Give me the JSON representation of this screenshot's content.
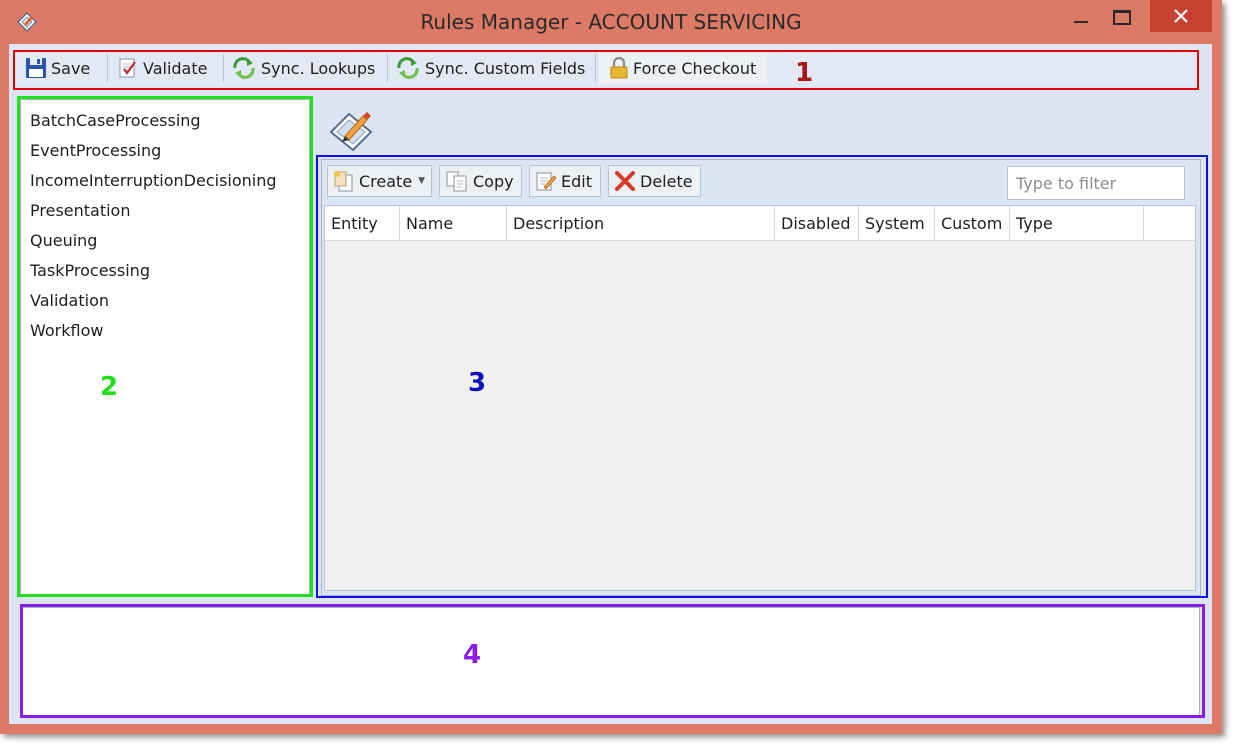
{
  "window": {
    "title": "Rules Manager - ACCOUNT SERVICING"
  },
  "toolbar": {
    "save": "Save",
    "validate": "Validate",
    "sync_lookups": "Sync. Lookups",
    "sync_custom_fields": "Sync. Custom Fields",
    "force_checkout": "Force Checkout"
  },
  "tree": {
    "items": [
      "BatchCaseProcessing",
      "EventProcessing",
      "IncomeInterruptionDecisioning",
      "Presentation",
      "Queuing",
      "TaskProcessing",
      "Validation",
      "Workflow"
    ]
  },
  "grid_toolbar": {
    "create": "Create",
    "copy": "Copy",
    "edit": "Edit",
    "delete": "Delete",
    "filter_placeholder": "Type to filter"
  },
  "grid": {
    "columns": [
      "Entity",
      "Name",
      "Description",
      "Disabled",
      "System",
      "Custom",
      "Type"
    ]
  },
  "annotations": {
    "region_1": "1",
    "region_2": "2",
    "region_3": "3",
    "region_4": "4",
    "colors": {
      "region_1": "#e60000",
      "region_2": "#22e01c",
      "region_3": "#1010e6",
      "region_4": "#8a1be8",
      "label_1": "#a81616",
      "label_2": "#22e01c",
      "label_3": "#1010c0",
      "label_4": "#8a1be8"
    }
  },
  "colors": {
    "title_bar": "#dc7a66",
    "close_button": "#c7402f",
    "client_background": "#dce5f3"
  }
}
